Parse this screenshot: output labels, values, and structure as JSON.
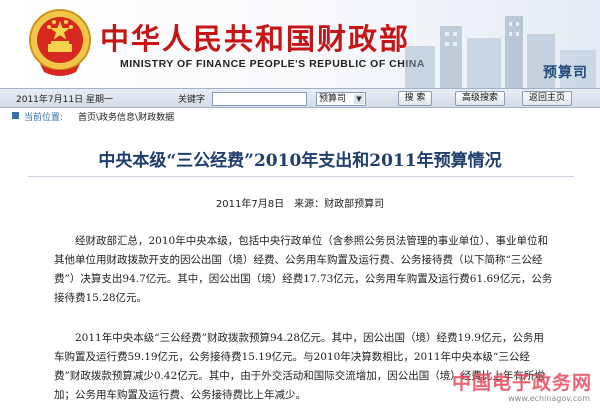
{
  "header": {
    "title_cn": "中华人民共和国财政部",
    "title_en": "MINISTRY OF FINANCE PEOPLE'S REPUBLIC OF CHINA",
    "department": "预算司",
    "emblem_icon": "national-emblem-icon"
  },
  "toolbar": {
    "date": "2011年7月11日 星期一",
    "keyword_label": "关键字",
    "keyword_value": "",
    "scope_selected": "预算司",
    "search_label": "搜 索",
    "advanced_search_label": "高级搜索",
    "return_home_label": "返回主页"
  },
  "breadcrumb": {
    "label": "当前位置:",
    "path": "首页\\政务信息\\财政数据"
  },
  "article": {
    "title": "中央本级“三公经费”2010年支出和2011年预算情况",
    "meta": "2011年7月8日　来源：财政部预算司",
    "paragraphs": [
      "经财政部汇总，2010年中央本级，包括中央行政单位（含参照公务员法管理的事业单位）、事业单位和其他单位用财政拨款开支的因公出国（境）经费、公务用车购置及运行费、公务接待费（以下简称“三公经费”）决算支出94.7亿元。其中，因公出国（境）经费17.73亿元，公务用车购置及运行费61.69亿元，公务接待费15.28亿元。",
      "2011年中央本级“三公经费”财政拨款预算94.28亿元。其中，因公出国（境）经费19.9亿元，公务用车购置及运行费59.19亿元，公务接待费15.19亿元。与2010年决算数相比，2011年中央本级“三公经费”财政拨款预算减少0.42亿元。其中，由于外交活动和国际交流增加，因公出国（境）经费比上年有所增加；公务用车购置及运行费、公务接待费比上年减少。"
    ]
  },
  "watermark": {
    "text": "中国电子政务网",
    "url": "www.echinagov.com"
  }
}
